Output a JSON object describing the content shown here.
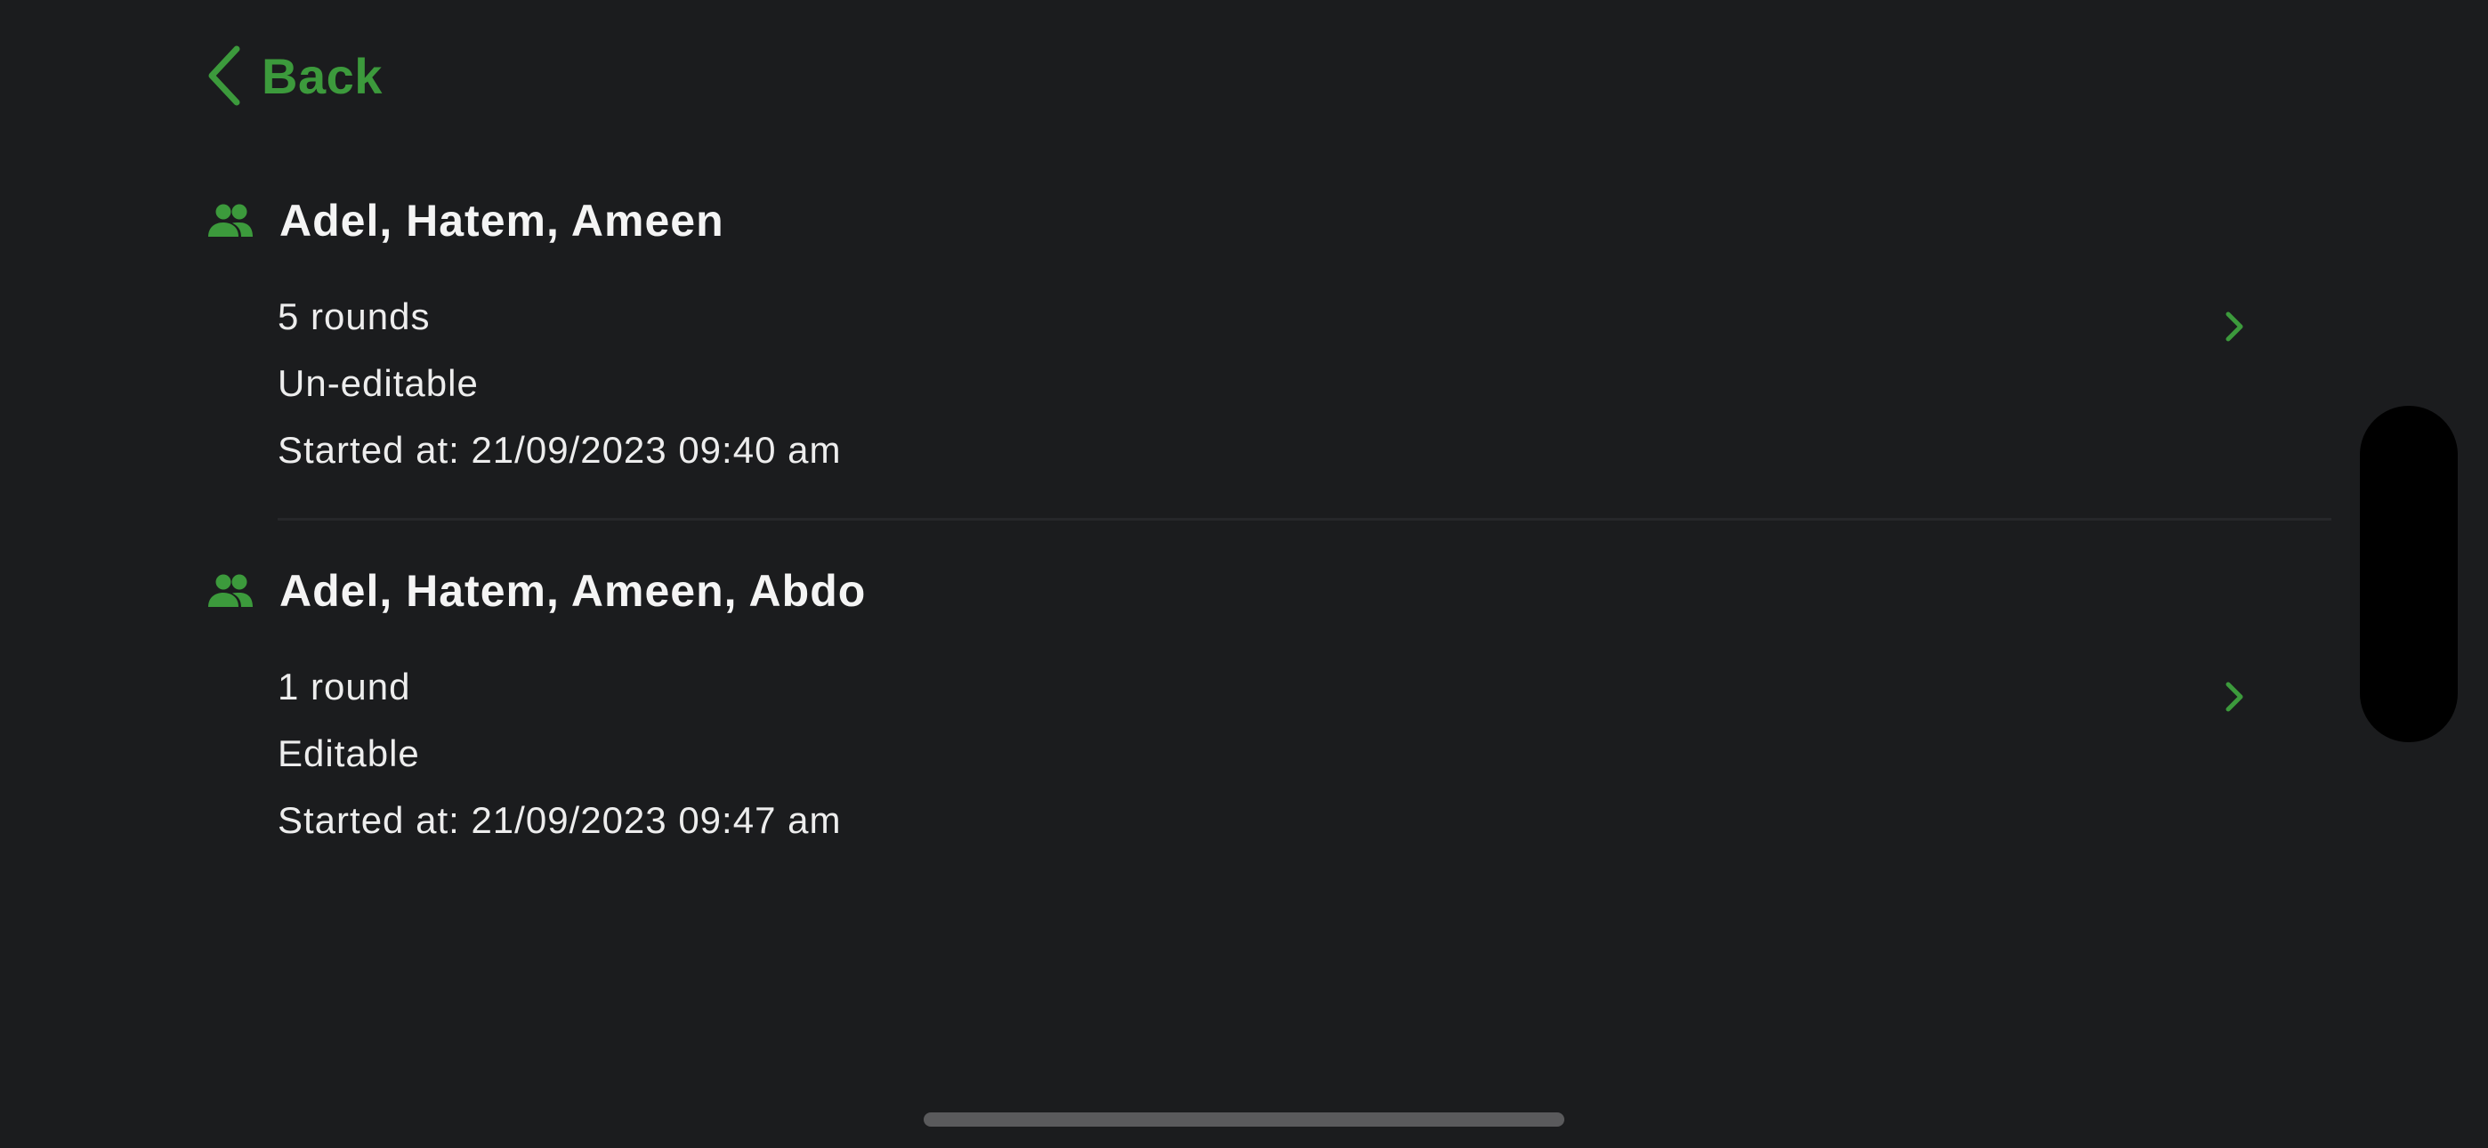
{
  "nav": {
    "back_label": "Back",
    "back_icon": "chevron-left-icon"
  },
  "colors": {
    "accent": "#3c9a3c",
    "background": "#1b1c1e",
    "text": "#f2f2f2"
  },
  "sessions": [
    {
      "players": "Adel, Hatem, Ameen",
      "rounds": "5 rounds",
      "editable": "Un-editable",
      "started": "Started at: 21/09/2023 09:40 am",
      "icon": "group-icon"
    },
    {
      "players": "Adel, Hatem, Ameen, Abdo",
      "rounds": "1 round",
      "editable": "Editable",
      "started": "Started at: 21/09/2023 09:47 am",
      "icon": "group-icon"
    }
  ]
}
